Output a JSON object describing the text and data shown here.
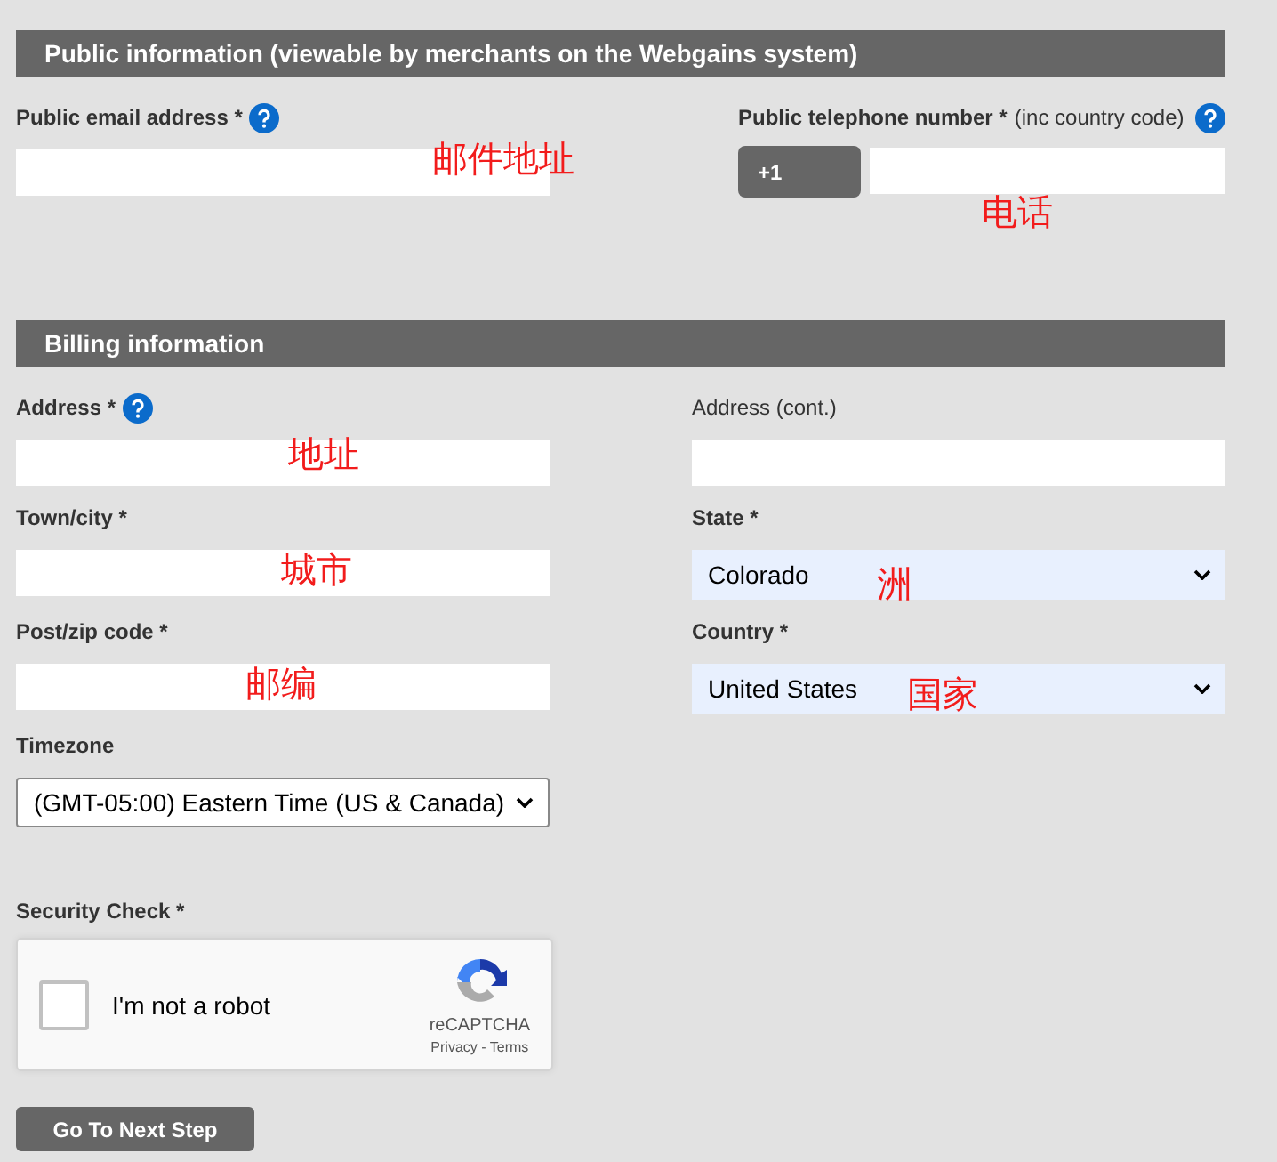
{
  "public_section": {
    "title": "Public information (viewable by merchants on the Webgains system)",
    "email": {
      "label": "Public email address *",
      "help": true,
      "annotation": "邮件地址"
    },
    "phone": {
      "label": "Public telephone number *",
      "note": "(inc country code)",
      "help": true,
      "prefix": "+1",
      "annotation": "电话"
    }
  },
  "billing_section": {
    "title": "Billing information",
    "fields": [
      {
        "kind": "text",
        "label": "Address *",
        "help": true,
        "annotation": "地址"
      },
      {
        "kind": "text",
        "label": "Address (cont.)",
        "light": true
      },
      {
        "kind": "text",
        "label": "Town/city *",
        "annotation": "城市"
      },
      {
        "kind": "select",
        "label": "State *",
        "value": "Colorado",
        "autofilled": true,
        "annotation": "洲"
      },
      {
        "kind": "text",
        "label": "Post/zip code *",
        "annotation": "邮编"
      },
      {
        "kind": "select",
        "label": "Country *",
        "value": "United States",
        "autofilled": true,
        "annotation": "国家"
      },
      {
        "kind": "select",
        "label": "Timezone",
        "value": "(GMT-05:00) Eastern Time (US & Canada)",
        "autofilled": false
      }
    ]
  },
  "security": {
    "label": "Security Check *",
    "checked": false,
    "checkbox_label": "I'm not a robot",
    "brand": "reCAPTCHA",
    "links": "Privacy - Terms"
  },
  "next_button": "Go To Next Step"
}
